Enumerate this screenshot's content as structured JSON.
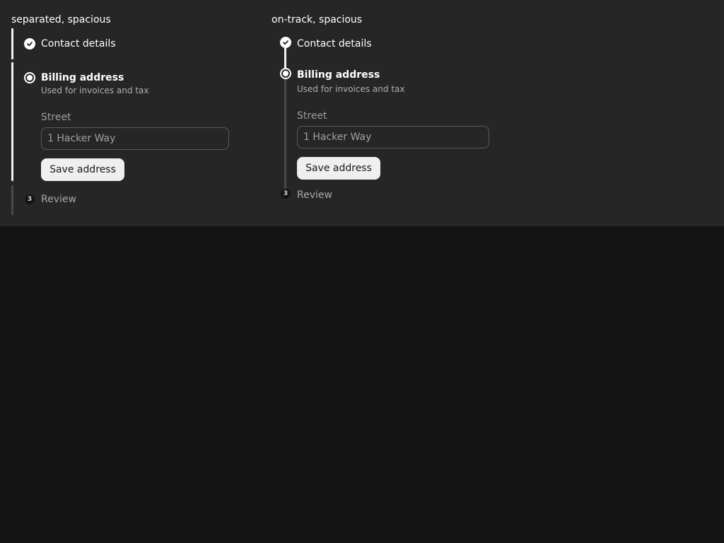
{
  "variants": [
    {
      "title": "separated, spacious",
      "steps": [
        {
          "label": "Contact details",
          "state": "done",
          "icon": "check-icon"
        },
        {
          "label": "Billing address",
          "state": "active",
          "icon": "radio-icon",
          "description": "Used for invoices and tax"
        },
        {
          "label": "Review",
          "state": "pending",
          "icon": "number-icon",
          "number": "3"
        }
      ],
      "form": {
        "street_label": "Street",
        "street_placeholder": "1 Hacker Way",
        "save_label": "Save address"
      }
    },
    {
      "title": "on-track, spacious",
      "steps": [
        {
          "label": "Contact details",
          "state": "done",
          "icon": "check-icon"
        },
        {
          "label": "Billing address",
          "state": "active",
          "icon": "radio-icon",
          "description": "Used for invoices and tax"
        },
        {
          "label": "Review",
          "state": "pending",
          "icon": "number-icon",
          "number": "3"
        }
      ],
      "form": {
        "street_label": "Street",
        "street_placeholder": "1 Hacker Way",
        "save_label": "Save address"
      }
    }
  ],
  "colors": {
    "page_background": "#141414",
    "panel_background": "#262626",
    "accent": "#f2f2f2",
    "muted_track": "#4a4a4a"
  }
}
